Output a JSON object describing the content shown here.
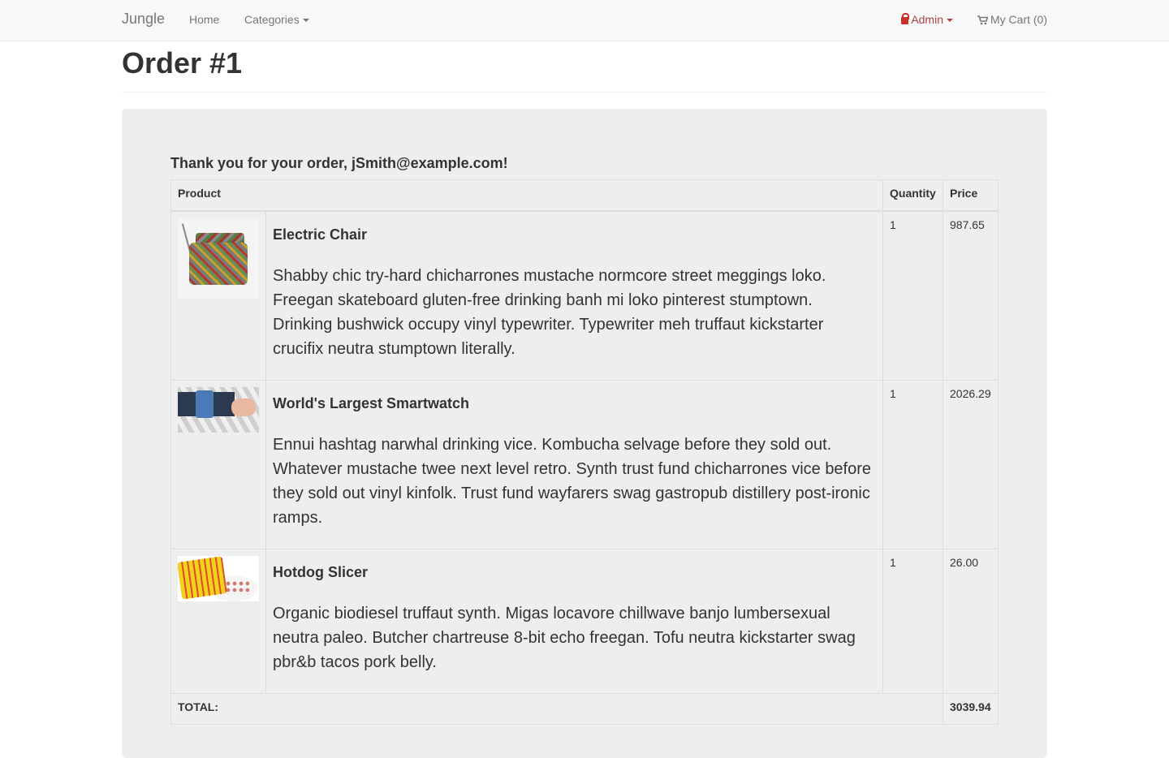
{
  "nav": {
    "brand": "Jungle",
    "home": "Home",
    "categories": "Categories",
    "admin": "Admin",
    "cart": "My Cart (0)"
  },
  "page": {
    "title": "Order #1"
  },
  "order": {
    "thanks": "Thank you for your order, jSmith@example.com!",
    "headers": {
      "product": "Product",
      "quantity": "Quantity",
      "price": "Price"
    },
    "items": [
      {
        "name": "Electric Chair",
        "description": "Shabby chic try-hard chicharrones mustache normcore street meggings loko. Freegan skateboard gluten-free drinking banh mi loko pinterest stumptown. Drinking bushwick occupy vinyl typewriter. Typewriter meh truffaut kickstarter crucifix neutra stumptown literally.",
        "quantity": "1",
        "price": "987.65"
      },
      {
        "name": "World's Largest Smartwatch",
        "description": "Ennui hashtag narwhal drinking vice. Kombucha selvage before they sold out. Whatever mustache twee next level retro. Synth trust fund chicharrones vice before they sold out vinyl kinfolk. Trust fund wayfarers swag gastropub distillery post-ironic ramps.",
        "quantity": "1",
        "price": "2026.29"
      },
      {
        "name": "Hotdog Slicer",
        "description": "Organic biodiesel truffaut synth. Migas locavore chillwave banjo lumbersexual neutra paleo. Butcher chartreuse 8-bit echo freegan. Tofu neutra kickstarter swag pbr&b tacos pork belly.",
        "quantity": "1",
        "price": "26.00"
      }
    ],
    "total_label": "TOTAL:",
    "total": "3039.94"
  }
}
